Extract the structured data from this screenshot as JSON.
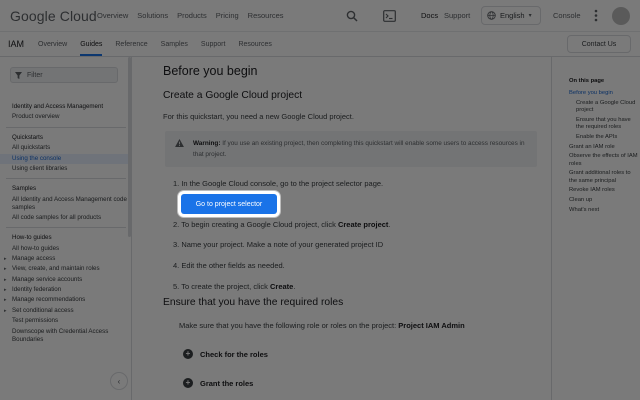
{
  "header": {
    "logo_text": "Google Cloud",
    "nav": [
      "Overview",
      "Solutions",
      "Products",
      "Pricing",
      "Resources"
    ],
    "docs_label": "Docs",
    "support_label": "Support",
    "language": "English",
    "console_label": "Console",
    "icons": {
      "search": "search-icon",
      "shell": "cloud-shell-icon",
      "language": "globe-icon",
      "more": "more-vert-icon"
    }
  },
  "subheader": {
    "product": "IAM",
    "tabs": [
      "Overview",
      "Guides",
      "Reference",
      "Samples",
      "Support",
      "Resources"
    ],
    "active_tab": "Guides",
    "contact_label": "Contact Us"
  },
  "sidebar": {
    "filter_placeholder": "Filter",
    "sections": [
      {
        "items": [
          {
            "label": "Identity and Access Management",
            "head": true
          },
          {
            "label": "Product overview"
          }
        ]
      },
      {
        "items": [
          {
            "label": "Quickstarts",
            "head": true
          },
          {
            "label": "All quickstarts"
          },
          {
            "label": "Using the console",
            "selected": true
          },
          {
            "label": "Using client libraries"
          }
        ]
      },
      {
        "items": [
          {
            "label": "Samples",
            "head": true
          },
          {
            "label": "All Identity and Access Management code samples",
            "wrap": true
          },
          {
            "label": "All code samples for all products"
          }
        ]
      },
      {
        "items": [
          {
            "label": "How-to guides",
            "head": true
          },
          {
            "label": "All how-to guides"
          },
          {
            "label": "Manage access",
            "expandable": true
          },
          {
            "label": "View, create, and maintain roles",
            "expandable": true
          },
          {
            "label": "Manage service accounts",
            "expandable": true
          },
          {
            "label": "Identity federation",
            "expandable": true
          },
          {
            "label": "Manage recommendations",
            "expandable": true
          },
          {
            "label": "Set conditional access",
            "expandable": true
          },
          {
            "label": "Test permissions"
          },
          {
            "label": "Downscope with Credential Access Boundaries",
            "wrap": true
          }
        ]
      }
    ]
  },
  "main": {
    "title": "Before you begin",
    "section1_title": "Create a Google Cloud project",
    "intro": "For this quickstart, you need a new Google Cloud project.",
    "warning_label": "Warning:",
    "warning_text": "If you use an existing project, then completing this quickstart will enable some users to access resources in that project.",
    "step1": "1. In the Google Cloud console, go to the project selector page.",
    "goto_button": "Go to project selector",
    "step2_pre": "2. To begin creating a Google Cloud project, click ",
    "step2_bold": "Create project",
    "step2_post": ".",
    "step3": "3. Name your project. Make a note of your generated project ID",
    "step4": "4. Edit the other fields as needed.",
    "step5_pre": "5. To create the project, click ",
    "step5_bold": "Create",
    "step5_post": ".",
    "section2_title": "Ensure that you have the required roles",
    "roles_pre": "Make sure that you have the following role or roles on the project: ",
    "roles_bold": "Project IAM Admin",
    "check_roles": "Check for the roles",
    "grant_roles": "Grant the roles"
  },
  "toc": {
    "title": "On this page",
    "items": [
      {
        "label": "Before you begin",
        "level": 0,
        "current": true
      },
      {
        "label": "Create a Google Cloud project",
        "level": 1
      },
      {
        "label": "Ensure that you have the required roles",
        "level": 1
      },
      {
        "label": "Enable the APIs",
        "level": 1
      },
      {
        "label": "Grant an IAM role",
        "level": 0
      },
      {
        "label": "Observe the effects of IAM roles",
        "level": 0
      },
      {
        "label": "Grant additional roles to the same principal",
        "level": 0
      },
      {
        "label": "Revoke IAM roles",
        "level": 0
      },
      {
        "label": "Clean up",
        "level": 0
      },
      {
        "label": "What's next",
        "level": 0
      }
    ]
  }
}
